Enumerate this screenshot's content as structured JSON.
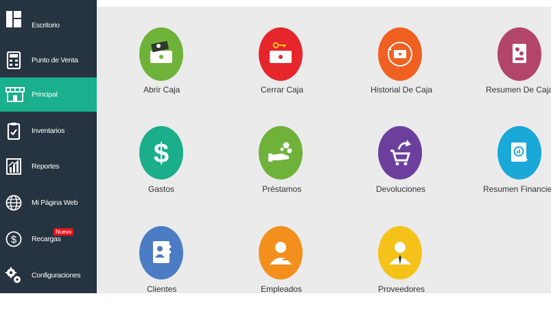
{
  "sidebar": {
    "items": [
      {
        "label": "Escritorio",
        "icon": "dashboard-icon"
      },
      {
        "label": "Punto de Venta",
        "icon": "calculator-icon"
      },
      {
        "label": "Principal",
        "icon": "store-icon"
      },
      {
        "label": "Inventarios",
        "icon": "clipboard-check-icon"
      },
      {
        "label": "Reportes",
        "icon": "bar-chart-icon"
      },
      {
        "label": "Mi Página Web",
        "icon": "globe-icon"
      },
      {
        "label": "Recargas",
        "icon": "dollar-circle-icon",
        "badge": "Nuevo"
      },
      {
        "label": "Configuraciones",
        "icon": "gears-icon"
      }
    ],
    "active_index": 2
  },
  "tiles": [
    {
      "label": "Abrir Caja",
      "color": "#6fb23a",
      "icon": "open-cash-register-icon"
    },
    {
      "label": "Cerrar Caja",
      "color": "#e6262b",
      "icon": "close-cash-register-icon"
    },
    {
      "label": "Historial De Caja",
      "color": "#f06021",
      "icon": "cash-history-icon"
    },
    {
      "label": "Resumen De Caja",
      "color": "#b3456b",
      "icon": "cash-summary-icon"
    },
    {
      "label": "Gastos",
      "color": "#1aae8b",
      "icon": "dollar-sign-icon"
    },
    {
      "label": "Préstamos",
      "color": "#6fb23a",
      "icon": "loan-hand-icon"
    },
    {
      "label": "Devoluciones",
      "color": "#6c3f9c",
      "icon": "return-cart-icon"
    },
    {
      "label": "Resumen Financiero",
      "color": "#1aa8d8",
      "icon": "financial-report-icon"
    },
    {
      "label": "Clientes",
      "color": "#4c7dc4",
      "icon": "contacts-book-icon"
    },
    {
      "label": "Empleados",
      "color": "#f3901d",
      "icon": "employee-icon"
    },
    {
      "label": "Proveedores",
      "color": "#f5c21a",
      "icon": "supplier-icon"
    }
  ],
  "colors": {
    "sidebar_bg": "#263340",
    "active_bg": "#1aaf8d",
    "main_bg": "#ebebeb",
    "badge_bg": "#e3141b"
  }
}
